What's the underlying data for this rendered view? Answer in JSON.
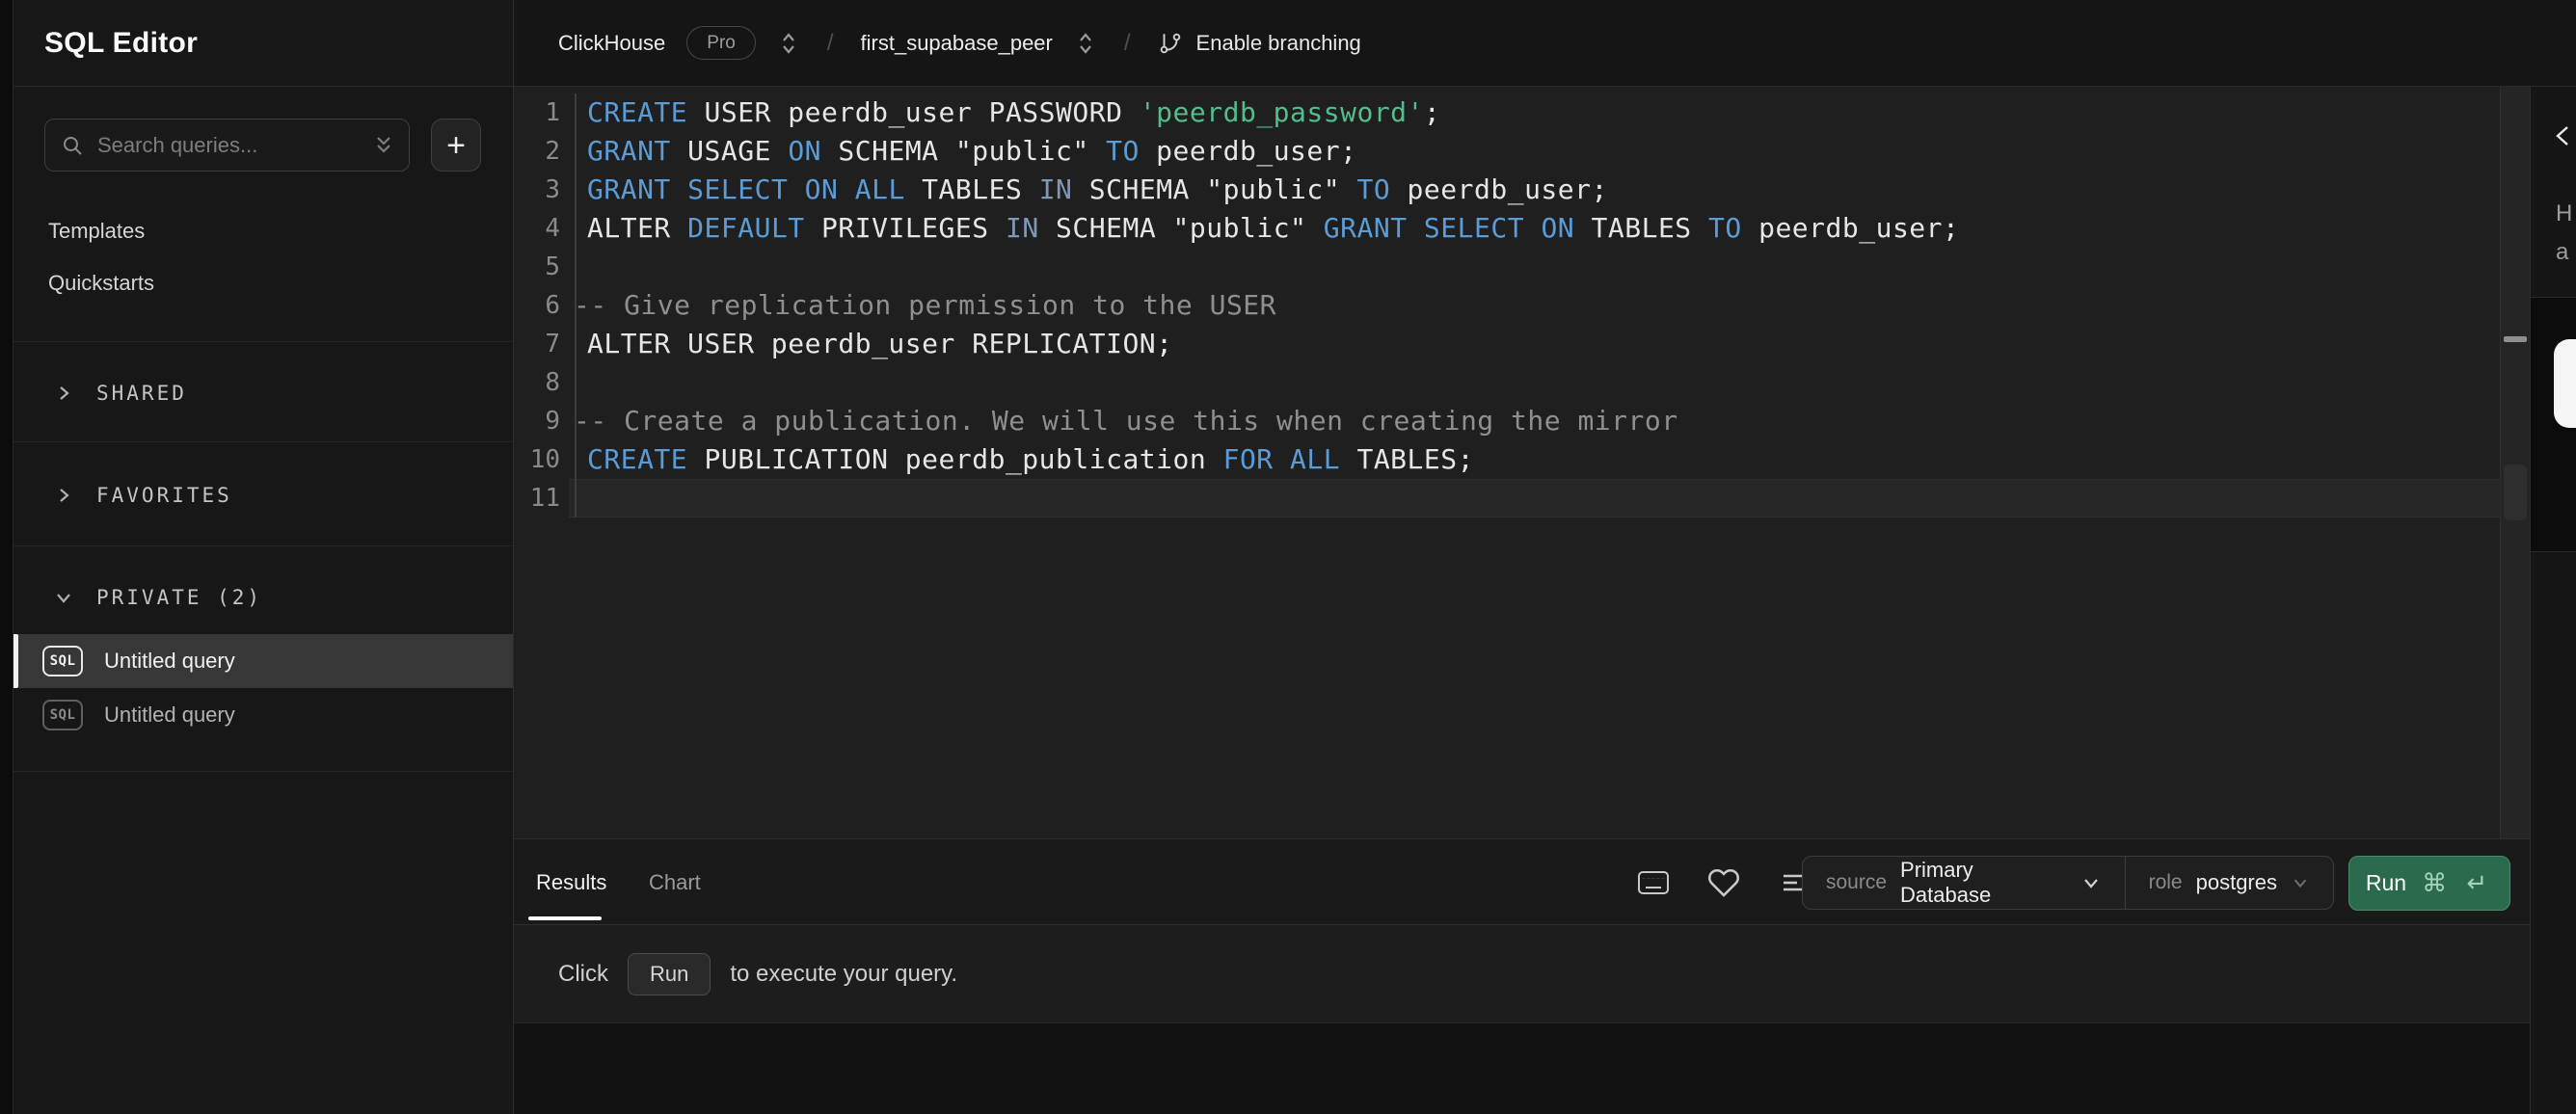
{
  "header": {
    "product": "ClickHouse",
    "plan_badge": "Pro",
    "separator": "/",
    "connection": "first_supabase_peer",
    "branching_label": "Enable branching"
  },
  "sidebar": {
    "title": "SQL Editor",
    "search_placeholder": "Search queries...",
    "new_query_button": "+",
    "links": [
      "Templates",
      "Quickstarts"
    ],
    "sections": [
      {
        "label": "SHARED",
        "collapsed": true
      },
      {
        "label": "FAVORITES",
        "collapsed": true
      },
      {
        "label": "PRIVATE (2)",
        "collapsed": false
      }
    ],
    "queries": [
      {
        "badge": "SQL",
        "label": "Untitled query",
        "selected": true
      },
      {
        "badge": "SQL",
        "label": "Untitled query",
        "selected": false
      }
    ]
  },
  "editor": {
    "lines": [
      {
        "no": 1,
        "tokens": [
          [
            "k",
            "CREATE"
          ],
          [
            "p",
            " USER peerdb_user PASSWORD "
          ],
          [
            "s",
            "'peerdb_password'"
          ],
          [
            "p",
            ";"
          ]
        ]
      },
      {
        "no": 2,
        "tokens": [
          [
            "k",
            "GRANT"
          ],
          [
            "p",
            " USAGE "
          ],
          [
            "k",
            "ON"
          ],
          [
            "p",
            " SCHEMA \"public\" "
          ],
          [
            "k",
            "TO"
          ],
          [
            "p",
            " peerdb_user;"
          ]
        ]
      },
      {
        "no": 3,
        "tokens": [
          [
            "k",
            "GRANT"
          ],
          [
            "p",
            " "
          ],
          [
            "k",
            "SELECT"
          ],
          [
            "p",
            " "
          ],
          [
            "k",
            "ON"
          ],
          [
            "p",
            " "
          ],
          [
            "k",
            "ALL"
          ],
          [
            "p",
            " TABLES "
          ],
          [
            "k2",
            "IN"
          ],
          [
            "p",
            " SCHEMA \"public\" "
          ],
          [
            "k",
            "TO"
          ],
          [
            "p",
            " peerdb_user;"
          ]
        ]
      },
      {
        "no": 4,
        "tokens": [
          [
            "p",
            "ALTER "
          ],
          [
            "k",
            "DEFAULT"
          ],
          [
            "p",
            " PRIVILEGES "
          ],
          [
            "k2",
            "IN"
          ],
          [
            "p",
            " SCHEMA \"public\" "
          ],
          [
            "k",
            "GRANT"
          ],
          [
            "p",
            " "
          ],
          [
            "k",
            "SELECT"
          ],
          [
            "p",
            " "
          ],
          [
            "k",
            "ON"
          ],
          [
            "p",
            " TABLES "
          ],
          [
            "k",
            "TO"
          ],
          [
            "p",
            " peerdb_user;"
          ]
        ]
      },
      {
        "no": 5,
        "tokens": []
      },
      {
        "no": 6,
        "tokens": [
          [
            "c",
            "-- Give replication permission to the USER"
          ]
        ]
      },
      {
        "no": 7,
        "tokens": [
          [
            "p",
            "ALTER USER peerdb_user REPLICATION;"
          ]
        ]
      },
      {
        "no": 8,
        "tokens": []
      },
      {
        "no": 9,
        "tokens": [
          [
            "c",
            "-- Create a publication. We will use this when creating the mirror"
          ]
        ]
      },
      {
        "no": 10,
        "tokens": [
          [
            "k",
            "CREATE"
          ],
          [
            "p",
            " PUBLICATION peerdb_publication "
          ],
          [
            "k",
            "FOR"
          ],
          [
            "p",
            " "
          ],
          [
            "k",
            "ALL"
          ],
          [
            "p",
            " TABLES;"
          ]
        ]
      },
      {
        "no": 11,
        "tokens": []
      }
    ]
  },
  "results_panel": {
    "tabs": [
      {
        "label": "Results",
        "active": true
      },
      {
        "label": "Chart",
        "active": false
      }
    ],
    "source_label": "source",
    "source_value": "Primary Database",
    "role_label": "role",
    "role_value": "postgres",
    "run_label": "Run",
    "run_shortcut": "⌘ ↵",
    "message": {
      "prefix": "Click",
      "kbd": "Run",
      "suffix": "to execute your query."
    }
  },
  "right_panel": {
    "truncated_text_1": "H",
    "truncated_text_2": "a"
  },
  "icons": {
    "search": "magnifier outline",
    "expand_list": "double chevron down",
    "new_query": "+",
    "section_collapsed": "chevron right",
    "section_expanded": "chevron down",
    "query_file": "SQL rounded badge",
    "switcher": "up-down unfold chevrons",
    "breadcrumb_separator": "/",
    "git_branch": "branch with two nodes",
    "keyboard_shortcuts": "keyboard outline",
    "favorite": "heart outline",
    "format_lines": "three left-aligned lines",
    "select_chevron": "chevron down",
    "cmd_key": "⌘",
    "return_key": "↵",
    "collapse_panel": "chevron left"
  },
  "colors": {
    "keyword": "#5b9cd6",
    "keyword_muted": "#7e99b5",
    "string": "#54bd8c",
    "comment": "#8f8f8f",
    "plain_code": "#e6e6e6",
    "run_button_green": "#2b6a4d",
    "selected_row": "#373737",
    "active_tab_underline": "#ffffff"
  }
}
